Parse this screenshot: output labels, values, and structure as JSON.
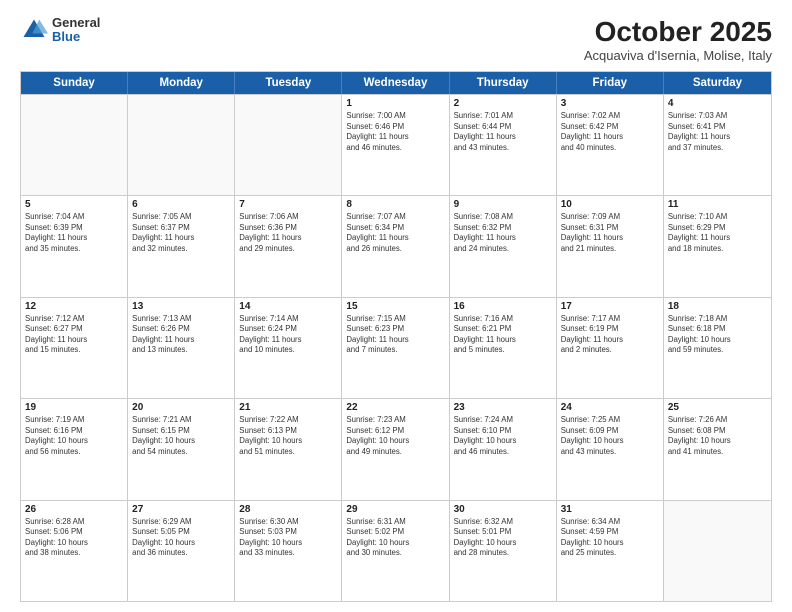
{
  "header": {
    "logo": {
      "general": "General",
      "blue": "Blue"
    },
    "title": "October 2025",
    "subtitle": "Acquaviva d'Isernia, Molise, Italy"
  },
  "weekdays": [
    "Sunday",
    "Monday",
    "Tuesday",
    "Wednesday",
    "Thursday",
    "Friday",
    "Saturday"
  ],
  "rows": [
    [
      {
        "day": "",
        "info": "",
        "empty": true
      },
      {
        "day": "",
        "info": "",
        "empty": true
      },
      {
        "day": "",
        "info": "",
        "empty": true
      },
      {
        "day": "1",
        "info": "Sunrise: 7:00 AM\nSunset: 6:46 PM\nDaylight: 11 hours\nand 46 minutes."
      },
      {
        "day": "2",
        "info": "Sunrise: 7:01 AM\nSunset: 6:44 PM\nDaylight: 11 hours\nand 43 minutes."
      },
      {
        "day": "3",
        "info": "Sunrise: 7:02 AM\nSunset: 6:42 PM\nDaylight: 11 hours\nand 40 minutes."
      },
      {
        "day": "4",
        "info": "Sunrise: 7:03 AM\nSunset: 6:41 PM\nDaylight: 11 hours\nand 37 minutes."
      }
    ],
    [
      {
        "day": "5",
        "info": "Sunrise: 7:04 AM\nSunset: 6:39 PM\nDaylight: 11 hours\nand 35 minutes."
      },
      {
        "day": "6",
        "info": "Sunrise: 7:05 AM\nSunset: 6:37 PM\nDaylight: 11 hours\nand 32 minutes."
      },
      {
        "day": "7",
        "info": "Sunrise: 7:06 AM\nSunset: 6:36 PM\nDaylight: 11 hours\nand 29 minutes."
      },
      {
        "day": "8",
        "info": "Sunrise: 7:07 AM\nSunset: 6:34 PM\nDaylight: 11 hours\nand 26 minutes."
      },
      {
        "day": "9",
        "info": "Sunrise: 7:08 AM\nSunset: 6:32 PM\nDaylight: 11 hours\nand 24 minutes."
      },
      {
        "day": "10",
        "info": "Sunrise: 7:09 AM\nSunset: 6:31 PM\nDaylight: 11 hours\nand 21 minutes."
      },
      {
        "day": "11",
        "info": "Sunrise: 7:10 AM\nSunset: 6:29 PM\nDaylight: 11 hours\nand 18 minutes."
      }
    ],
    [
      {
        "day": "12",
        "info": "Sunrise: 7:12 AM\nSunset: 6:27 PM\nDaylight: 11 hours\nand 15 minutes."
      },
      {
        "day": "13",
        "info": "Sunrise: 7:13 AM\nSunset: 6:26 PM\nDaylight: 11 hours\nand 13 minutes."
      },
      {
        "day": "14",
        "info": "Sunrise: 7:14 AM\nSunset: 6:24 PM\nDaylight: 11 hours\nand 10 minutes."
      },
      {
        "day": "15",
        "info": "Sunrise: 7:15 AM\nSunset: 6:23 PM\nDaylight: 11 hours\nand 7 minutes."
      },
      {
        "day": "16",
        "info": "Sunrise: 7:16 AM\nSunset: 6:21 PM\nDaylight: 11 hours\nand 5 minutes."
      },
      {
        "day": "17",
        "info": "Sunrise: 7:17 AM\nSunset: 6:19 PM\nDaylight: 11 hours\nand 2 minutes."
      },
      {
        "day": "18",
        "info": "Sunrise: 7:18 AM\nSunset: 6:18 PM\nDaylight: 10 hours\nand 59 minutes."
      }
    ],
    [
      {
        "day": "19",
        "info": "Sunrise: 7:19 AM\nSunset: 6:16 PM\nDaylight: 10 hours\nand 56 minutes."
      },
      {
        "day": "20",
        "info": "Sunrise: 7:21 AM\nSunset: 6:15 PM\nDaylight: 10 hours\nand 54 minutes."
      },
      {
        "day": "21",
        "info": "Sunrise: 7:22 AM\nSunset: 6:13 PM\nDaylight: 10 hours\nand 51 minutes."
      },
      {
        "day": "22",
        "info": "Sunrise: 7:23 AM\nSunset: 6:12 PM\nDaylight: 10 hours\nand 49 minutes."
      },
      {
        "day": "23",
        "info": "Sunrise: 7:24 AM\nSunset: 6:10 PM\nDaylight: 10 hours\nand 46 minutes."
      },
      {
        "day": "24",
        "info": "Sunrise: 7:25 AM\nSunset: 6:09 PM\nDaylight: 10 hours\nand 43 minutes."
      },
      {
        "day": "25",
        "info": "Sunrise: 7:26 AM\nSunset: 6:08 PM\nDaylight: 10 hours\nand 41 minutes."
      }
    ],
    [
      {
        "day": "26",
        "info": "Sunrise: 6:28 AM\nSunset: 5:06 PM\nDaylight: 10 hours\nand 38 minutes."
      },
      {
        "day": "27",
        "info": "Sunrise: 6:29 AM\nSunset: 5:05 PM\nDaylight: 10 hours\nand 36 minutes."
      },
      {
        "day": "28",
        "info": "Sunrise: 6:30 AM\nSunset: 5:03 PM\nDaylight: 10 hours\nand 33 minutes."
      },
      {
        "day": "29",
        "info": "Sunrise: 6:31 AM\nSunset: 5:02 PM\nDaylight: 10 hours\nand 30 minutes."
      },
      {
        "day": "30",
        "info": "Sunrise: 6:32 AM\nSunset: 5:01 PM\nDaylight: 10 hours\nand 28 minutes."
      },
      {
        "day": "31",
        "info": "Sunrise: 6:34 AM\nSunset: 4:59 PM\nDaylight: 10 hours\nand 25 minutes."
      },
      {
        "day": "",
        "info": "",
        "empty": true
      }
    ]
  ]
}
